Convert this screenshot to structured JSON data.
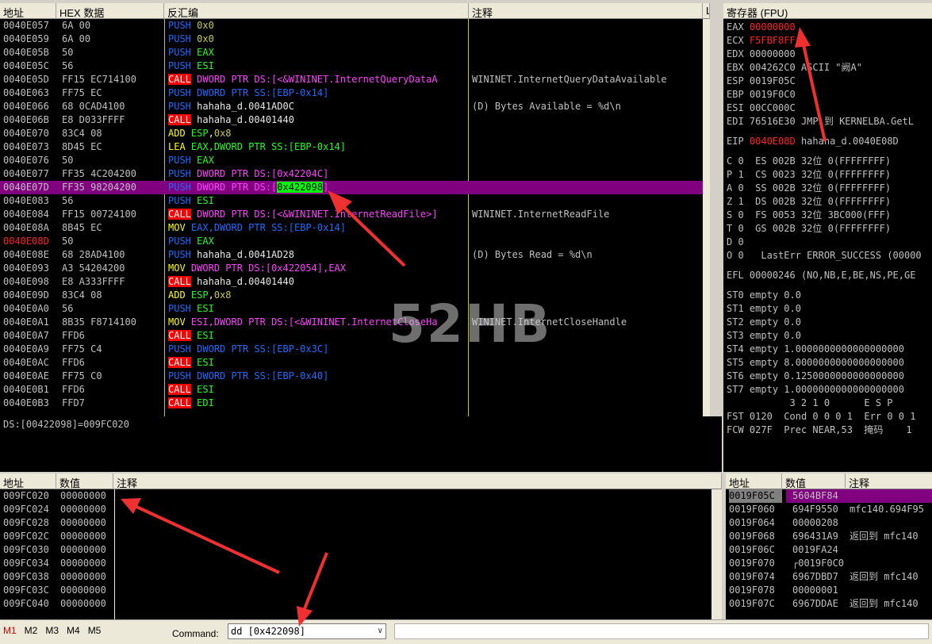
{
  "disasm": {
    "headers": [
      "地址",
      "HEX 数据",
      "反汇编",
      "注释",
      "L"
    ],
    "rows": [
      {
        "addr": "0040E057",
        "hex": "6A 00",
        "op": "PUSH",
        "args": [
          {
            "t": "0x0",
            "c": "num"
          }
        ],
        "cmt": ""
      },
      {
        "addr": "0040E059",
        "hex": "6A 00",
        "op": "PUSH",
        "args": [
          {
            "t": "0x0",
            "c": "num"
          }
        ],
        "cmt": ""
      },
      {
        "addr": "0040E05B",
        "hex": "50",
        "op": "PUSH",
        "args": [
          {
            "t": "EAX",
            "c": "reg"
          }
        ],
        "cmt": ""
      },
      {
        "addr": "0040E05C",
        "hex": "56",
        "op": "PUSH",
        "args": [
          {
            "t": "ESI",
            "c": "reg"
          }
        ],
        "cmt": ""
      },
      {
        "addr": "0040E05D",
        "hex": "FF15 EC714100",
        "op": "CALL",
        "args": [
          {
            "t": "DWORD PTR DS:[<&WININET.InternetQueryDataA",
            "c": "mag"
          }
        ],
        "cmt": "WININET.InternetQueryDataAvailable"
      },
      {
        "addr": "0040E063",
        "hex": "FF75 EC",
        "op": "PUSH",
        "args": [
          {
            "t": "DWORD PTR SS:[EBP-0x14]",
            "c": "push"
          }
        ],
        "cmt": ""
      },
      {
        "addr": "0040E066",
        "hex": "68 0CAD4100",
        "op": "PUSH",
        "args": [
          {
            "t": "hahaha_d.0041AD0C",
            "c": "white"
          }
        ],
        "cmt": "(D) Bytes Available = %d\\n"
      },
      {
        "addr": "0040E06B",
        "hex": "E8 D033FFFF",
        "op": "CALL",
        "args": [
          {
            "t": "hahaha_d.00401440",
            "c": "white"
          }
        ],
        "cmt": ""
      },
      {
        "addr": "0040E070",
        "hex": "83C4 08",
        "op": "ADD",
        "args": [
          {
            "t": "ESP",
            "c": "reg"
          },
          {
            "t": ",",
            "c": "white"
          },
          {
            "t": "0x8",
            "c": "num"
          }
        ],
        "cmt": ""
      },
      {
        "addr": "0040E073",
        "hex": "8D45 EC",
        "op": "LEA",
        "args": [
          {
            "t": "EAX,DWORD PTR SS:[EBP-0x14]",
            "c": "reg"
          }
        ],
        "cmt": ""
      },
      {
        "addr": "0040E076",
        "hex": "50",
        "op": "PUSH",
        "args": [
          {
            "t": "EAX",
            "c": "reg"
          }
        ],
        "cmt": ""
      },
      {
        "addr": "0040E077",
        "hex": "FF35 4C204200",
        "op": "PUSH",
        "args": [
          {
            "t": "DWORD PTR DS:[0x42204C]",
            "c": "mag"
          }
        ],
        "cmt": ""
      },
      {
        "addr": "0040E07D",
        "hex": "FF35 98204200",
        "op": "PUSH",
        "args": [
          {
            "t": "DWORD PTR DS:[",
            "c": "mag"
          },
          {
            "t": "0x422098",
            "c": "hl"
          },
          {
            "t": "]",
            "c": "mag"
          }
        ],
        "cmt": "",
        "selected": true
      },
      {
        "addr": "0040E083",
        "hex": "56",
        "op": "PUSH",
        "args": [
          {
            "t": "ESI",
            "c": "reg"
          }
        ],
        "cmt": ""
      },
      {
        "addr": "0040E084",
        "hex": "FF15 00724100",
        "op": "CALL",
        "args": [
          {
            "t": "DWORD PTR DS:[<&WININET.InternetReadFile>]",
            "c": "mag"
          }
        ],
        "cmt": "WININET.InternetReadFile"
      },
      {
        "addr": "0040E08A",
        "hex": "8B45 EC",
        "op": "MOV",
        "args": [
          {
            "t": "EAX,DWORD PTR SS:[EBP-0x14]",
            "c": "push"
          }
        ],
        "cmt": ""
      },
      {
        "addr": "0040E08D",
        "hex": "50",
        "op": "PUSH",
        "args": [
          {
            "t": "EAX",
            "c": "reg"
          }
        ],
        "cmt": "",
        "eip": true
      },
      {
        "addr": "0040E08E",
        "hex": "68 28AD4100",
        "op": "PUSH",
        "args": [
          {
            "t": "hahaha_d.0041AD28",
            "c": "white"
          }
        ],
        "cmt": "(D) Bytes Read = %d\\n"
      },
      {
        "addr": "0040E093",
        "hex": "A3 54204200",
        "op": "MOV",
        "args": [
          {
            "t": "DWORD PTR DS:[0x422054],EAX",
            "c": "mag"
          }
        ],
        "cmt": ""
      },
      {
        "addr": "0040E098",
        "hex": "E8 A333FFFF",
        "op": "CALL",
        "args": [
          {
            "t": "hahaha_d.00401440",
            "c": "white"
          }
        ],
        "cmt": ""
      },
      {
        "addr": "0040E09D",
        "hex": "83C4 08",
        "op": "ADD",
        "args": [
          {
            "t": "ESP",
            "c": "reg"
          },
          {
            "t": ",",
            "c": "white"
          },
          {
            "t": "0x8",
            "c": "num"
          }
        ],
        "cmt": ""
      },
      {
        "addr": "0040E0A0",
        "hex": "56",
        "op": "PUSH",
        "args": [
          {
            "t": "ESI",
            "c": "reg"
          }
        ],
        "cmt": ""
      },
      {
        "addr": "0040E0A1",
        "hex": "8B35 F8714100",
        "op": "MOV",
        "args": [
          {
            "t": "ESI,DWORD PTR DS:[<&WININET.InternetCloseHa",
            "c": "mag"
          }
        ],
        "cmt": "WININET.InternetCloseHandle"
      },
      {
        "addr": "0040E0A7",
        "hex": "FFD6",
        "op": "CALL",
        "args": [
          {
            "t": "ESI",
            "c": "reg"
          }
        ],
        "cmt": ""
      },
      {
        "addr": "0040E0A9",
        "hex": "FF75 C4",
        "op": "PUSH",
        "args": [
          {
            "t": "DWORD PTR SS:[EBP-0x3C]",
            "c": "push"
          }
        ],
        "cmt": ""
      },
      {
        "addr": "0040E0AC",
        "hex": "FFD6",
        "op": "CALL",
        "args": [
          {
            "t": "ESI",
            "c": "reg"
          }
        ],
        "cmt": ""
      },
      {
        "addr": "0040E0AE",
        "hex": "FF75 C0",
        "op": "PUSH",
        "args": [
          {
            "t": "DWORD PTR SS:[EBP-0x40]",
            "c": "push"
          }
        ],
        "cmt": ""
      },
      {
        "addr": "0040E0B1",
        "hex": "FFD6",
        "op": "CALL",
        "args": [
          {
            "t": "ESI",
            "c": "reg"
          }
        ],
        "cmt": ""
      },
      {
        "addr": "0040E0B3",
        "hex": "FFD7",
        "op": "CALL",
        "args": [
          {
            "t": "EDI",
            "c": "reg"
          }
        ],
        "cmt": ""
      }
    ]
  },
  "info_line": "DS:[00422098]=009FC020",
  "watermark": "52HB",
  "registers": {
    "title": "寄存器 (FPU)",
    "lines": [
      {
        "label": "EAX",
        "value": "00000000",
        "rest": "",
        "red": true
      },
      {
        "label": "ECX",
        "value": "F5FBF8FF",
        "rest": "",
        "red": true
      },
      {
        "label": "EDX",
        "value": "00000000",
        "rest": ""
      },
      {
        "label": "EBX",
        "value": "004262C0",
        "rest": " ASCII \"阙A\""
      },
      {
        "label": "ESP",
        "value": "0019F05C",
        "rest": ""
      },
      {
        "label": "EBP",
        "value": "0019F0C0",
        "rest": ""
      },
      {
        "label": "ESI",
        "value": "00CC000C",
        "rest": ""
      },
      {
        "label": "EDI",
        "value": "76516E30",
        "rest": " JMP 到 KERNELBA.GetL"
      },
      {
        "label": "",
        "value": "",
        "rest": ""
      },
      {
        "label": "EIP",
        "value": "0040E08D",
        "rest": " hahaha_d.0040E08D",
        "red": true
      },
      {
        "label": "",
        "value": "",
        "rest": ""
      },
      {
        "label": "C 0",
        "value": "",
        "rest": " ES 002B 32位 0(FFFFFFFF)"
      },
      {
        "label": "P 1",
        "value": "",
        "rest": " CS 0023 32位 0(FFFFFFFF)"
      },
      {
        "label": "A 0",
        "value": "",
        "rest": " SS 002B 32位 0(FFFFFFFF)"
      },
      {
        "label": "Z 1",
        "value": "",
        "rest": " DS 002B 32位 0(FFFFFFFF)"
      },
      {
        "label": "S 0",
        "value": "",
        "rest": " FS 0053 32位 3BC000(FFF)"
      },
      {
        "label": "T 0",
        "value": "",
        "rest": " GS 002B 32位 0(FFFFFFFF)"
      },
      {
        "label": "D 0",
        "value": "",
        "rest": ""
      },
      {
        "label": "O 0",
        "value": "",
        "rest": "  LastErr ERROR_SUCCESS (00000"
      },
      {
        "label": "",
        "value": "",
        "rest": ""
      },
      {
        "label": "EFL",
        "value": "00000246",
        "rest": " (NO,NB,E,BE,NS,PE,GE"
      },
      {
        "label": "",
        "value": "",
        "rest": ""
      },
      {
        "label": "ST0",
        "value": "empty",
        "rest": " 0.0"
      },
      {
        "label": "ST1",
        "value": "empty",
        "rest": " 0.0"
      },
      {
        "label": "ST2",
        "value": "empty",
        "rest": " 0.0"
      },
      {
        "label": "ST3",
        "value": "empty",
        "rest": " 0.0"
      },
      {
        "label": "ST4",
        "value": "empty",
        "rest": " 1.0000000000000000000"
      },
      {
        "label": "ST5",
        "value": "empty",
        "rest": " 8.0000000000000000000"
      },
      {
        "label": "ST6",
        "value": "empty",
        "rest": " 0.1250000000000000000"
      },
      {
        "label": "ST7",
        "value": "empty",
        "rest": " 1.0000000000000000000"
      },
      {
        "label": "",
        "value": "",
        "rest": "           3 2 1 0      E S P"
      },
      {
        "label": "FST",
        "value": "0120",
        "rest": "  Cond 0 0 0 1  Err 0 0 1"
      },
      {
        "label": "FCW",
        "value": "027F",
        "rest": "  Prec NEAR,53  掩码    1"
      }
    ]
  },
  "dump": {
    "headers": [
      "地址",
      "数值",
      "注释"
    ],
    "rows": [
      {
        "addr": "009FC020",
        "val": "00000000"
      },
      {
        "addr": "009FC024",
        "val": "00000000"
      },
      {
        "addr": "009FC028",
        "val": "00000000"
      },
      {
        "addr": "009FC02C",
        "val": "00000000"
      },
      {
        "addr": "009FC030",
        "val": "00000000"
      },
      {
        "addr": "009FC034",
        "val": "00000000"
      },
      {
        "addr": "009FC038",
        "val": "00000000"
      },
      {
        "addr": "009FC03C",
        "val": "00000000"
      },
      {
        "addr": "009FC040",
        "val": "00000000"
      }
    ]
  },
  "stack": {
    "headers": [
      "地址",
      "数值",
      "注释"
    ],
    "rows": [
      {
        "addr": "0019F05C",
        "val": "5604BF84",
        "cmt": "",
        "selected": true
      },
      {
        "addr": "0019F060",
        "val": "694F9550",
        "cmt": "mfc140.694F95"
      },
      {
        "addr": "0019F064",
        "val": "00000208",
        "cmt": ""
      },
      {
        "addr": "0019F068",
        "val": "696431A9",
        "cmt": "返回到 mfc140"
      },
      {
        "addr": "0019F06C",
        "val": "0019FA24",
        "cmt": ""
      },
      {
        "addr": "0019F070",
        "val": "┌0019F0C0",
        "cmt": ""
      },
      {
        "addr": "0019F074",
        "val": "6967DBD7",
        "cmt": "返回到 mfc140"
      },
      {
        "addr": "0019F078",
        "val": "00000001",
        "cmt": ""
      },
      {
        "addr": "0019F07C",
        "val": "6967DDAE",
        "cmt": "返回到 mfc140"
      }
    ]
  },
  "bottom": {
    "tabs": [
      "M1",
      "M2",
      "M3",
      "M4",
      "M5"
    ],
    "active_tab": 0,
    "command_label": "Command:",
    "command_value": "dd [0x422098]"
  },
  "colors": {
    "annotation_arrow": "#ee3030",
    "selection": "#800080",
    "eip": "#ff2020"
  }
}
